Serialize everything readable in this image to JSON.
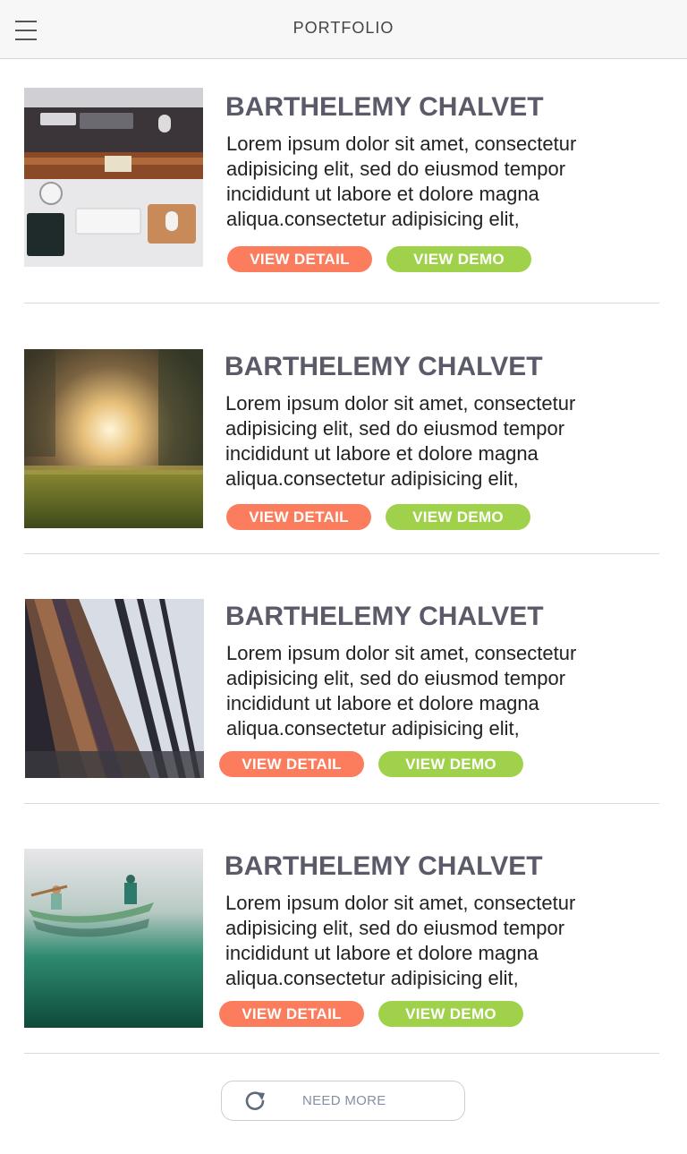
{
  "header": {
    "title": "PORTFOLIO",
    "menu_icon": "hamburger-menu-icon"
  },
  "items": [
    {
      "image": "workspace-desk-photo",
      "title": "BARTHELEMY CHALVET",
      "description": "Lorem ipsum dolor sit amet, consectetur adipisicing elit, sed do eiusmod tempor incididunt ut labore et dolore magna aliqua.consectetur adipisicing elit,",
      "detail_label": "VIEW DETAIL",
      "demo_label": "VIEW DEMO"
    },
    {
      "image": "sunset-grass-photo",
      "title": "BARTHELEMY CHALVET",
      "description": "Lorem ipsum dolor sit amet, consectetur adipisicing elit, sed do eiusmod tempor incididunt ut labore et dolore magna aliqua.consectetur adipisicing elit,",
      "detail_label": "VIEW DETAIL",
      "demo_label": "VIEW DEMO"
    },
    {
      "image": "library-shelves-photo",
      "title": "BARTHELEMY CHALVET",
      "description": "Lorem ipsum dolor sit amet, consectetur adipisicing elit, sed do eiusmod tempor incididunt ut labore et dolore magna aliqua.consectetur adipisicing elit,",
      "detail_label": "VIEW DETAIL",
      "demo_label": "VIEW DEMO"
    },
    {
      "image": "canoe-lake-photo",
      "title": "BARTHELEMY CHALVET",
      "description": "Lorem ipsum dolor sit amet, consectetur adipisicing elit, sed do eiusmod tempor incididunt ut labore et dolore magna aliqua.consectetur adipisicing elit,",
      "detail_label": "VIEW DETAIL",
      "demo_label": "VIEW DEMO"
    }
  ],
  "load_more": {
    "label": "NEED MORE",
    "icon": "refresh-icon"
  },
  "colors": {
    "detail_button": "#fb7d5e",
    "demo_button": "#a0d14b",
    "title_text": "#5a5a68"
  }
}
